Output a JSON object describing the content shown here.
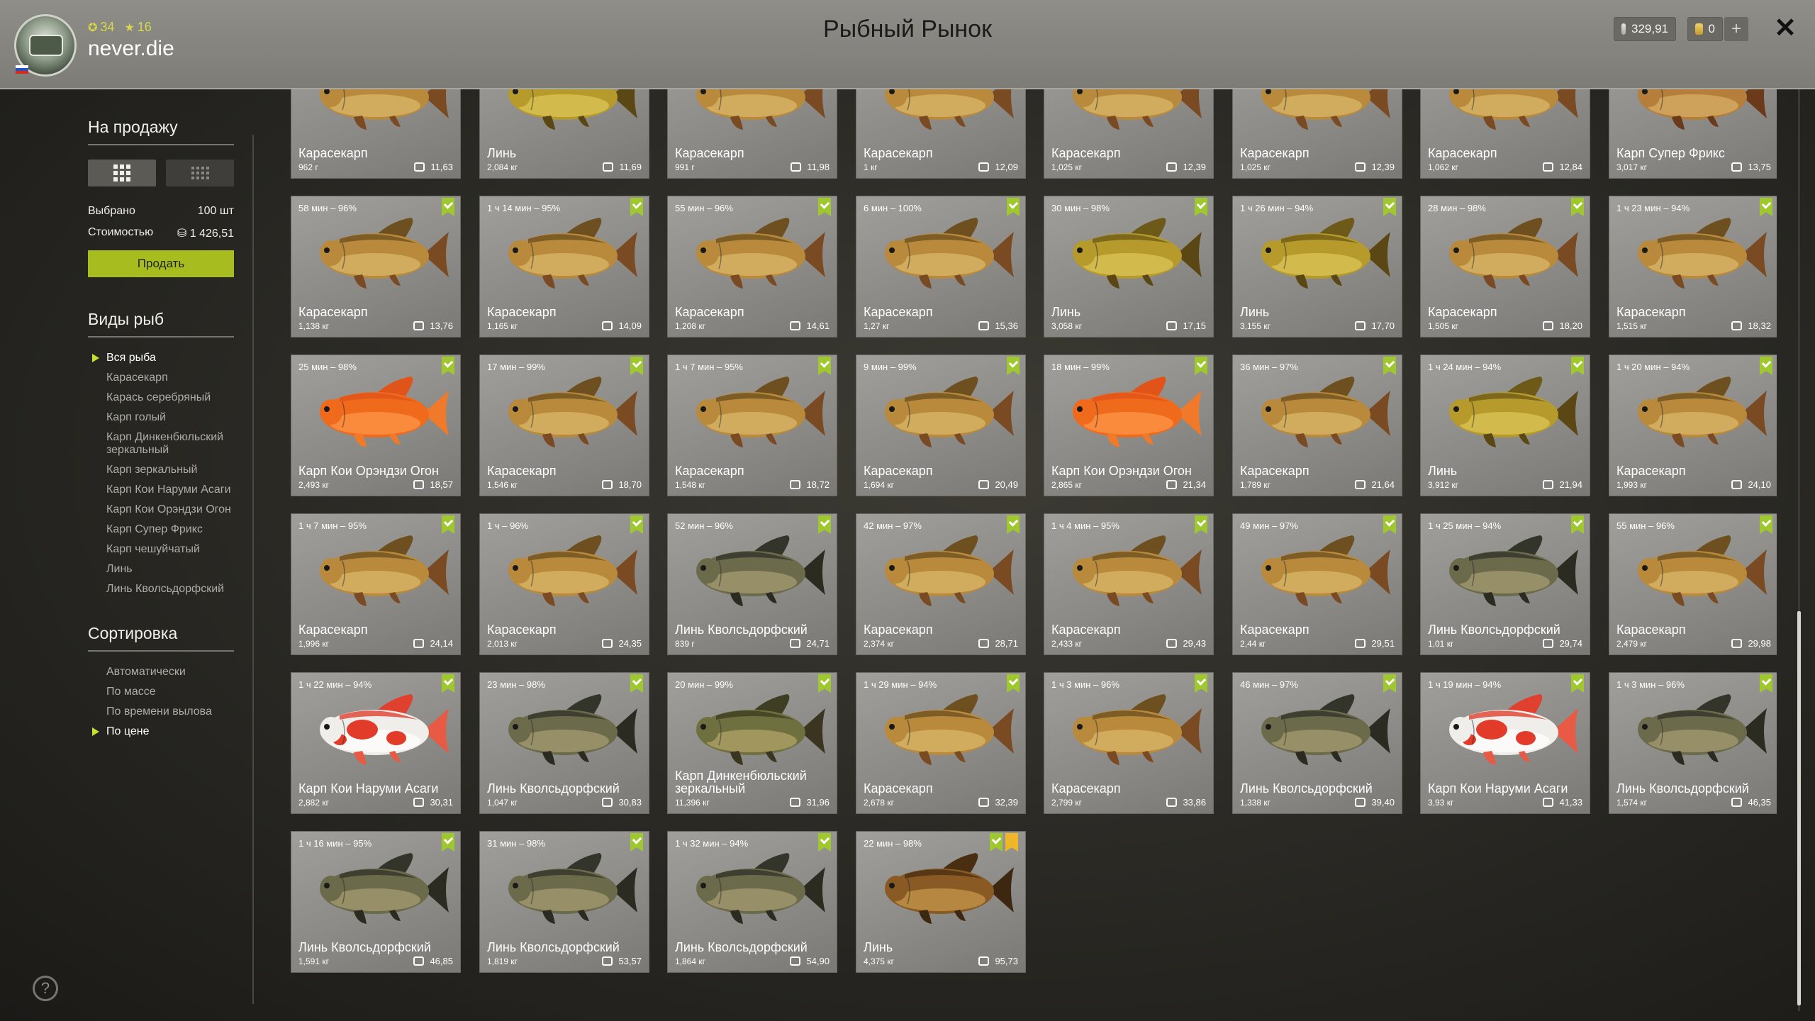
{
  "header": {
    "title": "Рыбный Рынок",
    "level": "34",
    "stars": "16",
    "username": "never.die",
    "silver": "329,91",
    "gold": "0",
    "plus_label": "+",
    "close_label": "✕"
  },
  "sidebar": {
    "sale_title": "На продажу",
    "selected_label": "Выбрано",
    "selected_value": "100 шт",
    "cost_label": "Стоимостью",
    "cost_value": "1 426,51",
    "sell_button": "Продать",
    "species_title": "Виды рыб",
    "species": [
      {
        "label": "Вся рыба",
        "active": true
      },
      {
        "label": "Карасекарп",
        "active": false
      },
      {
        "label": "Карась серебряный",
        "active": false
      },
      {
        "label": "Карп голый",
        "active": false
      },
      {
        "label": "Карп Динкенбюльский зеркальный",
        "active": false
      },
      {
        "label": "Карп зеркальный",
        "active": false
      },
      {
        "label": "Карп Кои Наруми Асаги",
        "active": false
      },
      {
        "label": "Карп Кои Орэндзи Огон",
        "active": false
      },
      {
        "label": "Карп Супер Фрикс",
        "active": false
      },
      {
        "label": "Карп чешуйчатый",
        "active": false
      },
      {
        "label": "Линь",
        "active": false
      },
      {
        "label": "Линь Кволсьдорфский",
        "active": false
      }
    ],
    "sort_title": "Сортировка",
    "sort_options": [
      {
        "label": "Автоматически",
        "active": false
      },
      {
        "label": "По массе",
        "active": false
      },
      {
        "label": "По времени вылова",
        "active": false
      },
      {
        "label": "По цене",
        "active": true
      }
    ],
    "help_label": "?"
  },
  "fish": [
    {
      "name": "Карасекарп",
      "weight": "962 г",
      "price": "11,63",
      "time": "",
      "checked": false,
      "starred": false,
      "kind": "carp"
    },
    {
      "name": "Линь",
      "weight": "2,084 кг",
      "price": "11,69",
      "time": "",
      "checked": false,
      "starred": false,
      "kind": "tench"
    },
    {
      "name": "Карасекарп",
      "weight": "991 г",
      "price": "11,98",
      "time": "",
      "checked": false,
      "starred": false,
      "kind": "carp"
    },
    {
      "name": "Карасекарп",
      "weight": "1 кг",
      "price": "12,09",
      "time": "",
      "checked": false,
      "starred": false,
      "kind": "carp"
    },
    {
      "name": "Карасекарп",
      "weight": "1,025 кг",
      "price": "12,39",
      "time": "",
      "checked": false,
      "starred": false,
      "kind": "carp"
    },
    {
      "name": "Карасекарп",
      "weight": "1,025 кг",
      "price": "12,39",
      "time": "",
      "checked": false,
      "starred": false,
      "kind": "carp"
    },
    {
      "name": "Карасекарп",
      "weight": "1,062 кг",
      "price": "12,84",
      "time": "",
      "checked": false,
      "starred": false,
      "kind": "carp"
    },
    {
      "name": "Карп Супер Фрикс",
      "weight": "3,017 кг",
      "price": "13,75",
      "time": "",
      "checked": false,
      "starred": false,
      "kind": "mirror"
    },
    {
      "name": "Карасекарп",
      "weight": "1,138 кг",
      "price": "13,76",
      "time": "58 мин – 96%",
      "checked": true,
      "starred": false,
      "kind": "carp"
    },
    {
      "name": "Карасекарп",
      "weight": "1,165 кг",
      "price": "14,09",
      "time": "1 ч 14 мин – 95%",
      "checked": true,
      "starred": false,
      "kind": "carp"
    },
    {
      "name": "Карасекарп",
      "weight": "1,208 кг",
      "price": "14,61",
      "time": "55 мин – 96%",
      "checked": true,
      "starred": false,
      "kind": "carp"
    },
    {
      "name": "Карасекарп",
      "weight": "1,27 кг",
      "price": "15,36",
      "time": "6 мин – 100%",
      "checked": true,
      "starred": false,
      "kind": "carp"
    },
    {
      "name": "Линь",
      "weight": "3,058 кг",
      "price": "17,15",
      "time": "30 мин – 98%",
      "checked": true,
      "starred": false,
      "kind": "tench"
    },
    {
      "name": "Линь",
      "weight": "3,155 кг",
      "price": "17,70",
      "time": "1 ч 26 мин – 94%",
      "checked": true,
      "starred": false,
      "kind": "tench"
    },
    {
      "name": "Карасекарп",
      "weight": "1,505 кг",
      "price": "18,20",
      "time": "28 мин – 98%",
      "checked": true,
      "starred": false,
      "kind": "carp"
    },
    {
      "name": "Карасекарп",
      "weight": "1,515 кг",
      "price": "18,32",
      "time": "1 ч 23 мин – 94%",
      "checked": true,
      "starred": false,
      "kind": "carp"
    },
    {
      "name": "Карп Кои Орэндзи Огон",
      "weight": "2,493 кг",
      "price": "18,57",
      "time": "25 мин – 98%",
      "checked": true,
      "starred": false,
      "kind": "koi_orange"
    },
    {
      "name": "Карасекарп",
      "weight": "1,546 кг",
      "price": "18,70",
      "time": "17 мин – 99%",
      "checked": true,
      "starred": false,
      "kind": "carp"
    },
    {
      "name": "Карасекарп",
      "weight": "1,548 кг",
      "price": "18,72",
      "time": "1 ч 7 мин – 95%",
      "checked": true,
      "starred": false,
      "kind": "carp"
    },
    {
      "name": "Карасекарп",
      "weight": "1,694 кг",
      "price": "20,49",
      "time": "9 мин – 99%",
      "checked": true,
      "starred": false,
      "kind": "carp"
    },
    {
      "name": "Карп Кои Орэндзи Огон",
      "weight": "2,865 кг",
      "price": "21,34",
      "time": "18 мин – 99%",
      "checked": true,
      "starred": false,
      "kind": "koi_orange"
    },
    {
      "name": "Карасекарп",
      "weight": "1,789 кг",
      "price": "21,64",
      "time": "36 мин – 97%",
      "checked": true,
      "starred": false,
      "kind": "carp"
    },
    {
      "name": "Линь",
      "weight": "3,912 кг",
      "price": "21,94",
      "time": "1 ч 24 мин – 94%",
      "checked": true,
      "starred": false,
      "kind": "tench"
    },
    {
      "name": "Карасекарп",
      "weight": "1,993 кг",
      "price": "24,10",
      "time": "1 ч 20 мин – 94%",
      "checked": true,
      "starred": false,
      "kind": "carp"
    },
    {
      "name": "Карасекарп",
      "weight": "1,996 кг",
      "price": "24,14",
      "time": "1 ч 7 мин – 95%",
      "checked": true,
      "starred": false,
      "kind": "carp"
    },
    {
      "name": "Карасекарп",
      "weight": "2,013 кг",
      "price": "24,35",
      "time": "1 ч – 96%",
      "checked": true,
      "starred": false,
      "kind": "carp"
    },
    {
      "name": "Линь Кволсьдорфский",
      "weight": "839 г",
      "price": "24,71",
      "time": "52 мин – 96%",
      "checked": true,
      "starred": false,
      "kind": "tench_dark"
    },
    {
      "name": "Карасекарп",
      "weight": "2,374 кг",
      "price": "28,71",
      "time": "42 мин – 97%",
      "checked": true,
      "starred": false,
      "kind": "carp"
    },
    {
      "name": "Карасекарп",
      "weight": "2,433 кг",
      "price": "29,43",
      "time": "1 ч 4 мин – 95%",
      "checked": true,
      "starred": false,
      "kind": "carp"
    },
    {
      "name": "Карасекарп",
      "weight": "2,44 кг",
      "price": "29,51",
      "time": "49 мин – 97%",
      "checked": true,
      "starred": false,
      "kind": "carp"
    },
    {
      "name": "Линь Кволсьдорфский",
      "weight": "1,01 кг",
      "price": "29,74",
      "time": "1 ч 25 мин – 94%",
      "checked": true,
      "starred": false,
      "kind": "tench_dark"
    },
    {
      "name": "Карасекарп",
      "weight": "2,479 кг",
      "price": "29,98",
      "time": "55 мин – 96%",
      "checked": true,
      "starred": false,
      "kind": "carp"
    },
    {
      "name": "Карп Кои Наруми Асаги",
      "weight": "2,882 кг",
      "price": "30,31",
      "time": "1 ч 22 мин – 94%",
      "checked": true,
      "starred": false,
      "kind": "koi_white"
    },
    {
      "name": "Линь Кволсьдорфский",
      "weight": "1,047 кг",
      "price": "30,83",
      "time": "23 мин – 98%",
      "checked": true,
      "starred": false,
      "kind": "tench_dark"
    },
    {
      "name": "Карп Динкенбюльский зеркальный",
      "weight": "11,396 кг",
      "price": "31,96",
      "time": "20 мин – 99%",
      "checked": true,
      "starred": false,
      "kind": "mirror_green"
    },
    {
      "name": "Карасекарп",
      "weight": "2,678 кг",
      "price": "32,39",
      "time": "1 ч 29 мин – 94%",
      "checked": true,
      "starred": false,
      "kind": "carp"
    },
    {
      "name": "Карасекарп",
      "weight": "2,799 кг",
      "price": "33,86",
      "time": "1 ч 3 мин – 96%",
      "checked": true,
      "starred": false,
      "kind": "carp"
    },
    {
      "name": "Линь Кволсьдорфский",
      "weight": "1,338 кг",
      "price": "39,40",
      "time": "46 мин – 97%",
      "checked": true,
      "starred": false,
      "kind": "tench_dark"
    },
    {
      "name": "Карп Кои Наруми Асаги",
      "weight": "3,93 кг",
      "price": "41,33",
      "time": "1 ч 19 мин – 94%",
      "checked": true,
      "starred": false,
      "kind": "koi_white"
    },
    {
      "name": "Линь Кволсьдорфский",
      "weight": "1,574 кг",
      "price": "46,35",
      "time": "1 ч 3 мин – 96%",
      "checked": true,
      "starred": false,
      "kind": "tench_dark"
    },
    {
      "name": "Линь Кволсьдорфский",
      "weight": "1,591 кг",
      "price": "46,85",
      "time": "1 ч 16 мин – 95%",
      "checked": true,
      "starred": false,
      "kind": "tench_dark"
    },
    {
      "name": "Линь Кволсьдорфский",
      "weight": "1,819 кг",
      "price": "53,57",
      "time": "31 мин – 98%",
      "checked": true,
      "starred": false,
      "kind": "tench_dark"
    },
    {
      "name": "Линь Кволсьдорфский",
      "weight": "1,864 кг",
      "price": "54,90",
      "time": "1 ч 32 мин – 94%",
      "checked": true,
      "starred": false,
      "kind": "tench_dark"
    },
    {
      "name": "Линь",
      "weight": "4,375 кг",
      "price": "95,73",
      "time": "22 мин – 98%",
      "checked": true,
      "starred": true,
      "kind": "tench_brown"
    }
  ],
  "colors": {
    "accent": "#a7bd1f",
    "check": "#9fc72e",
    "star": "#f0b62a"
  }
}
